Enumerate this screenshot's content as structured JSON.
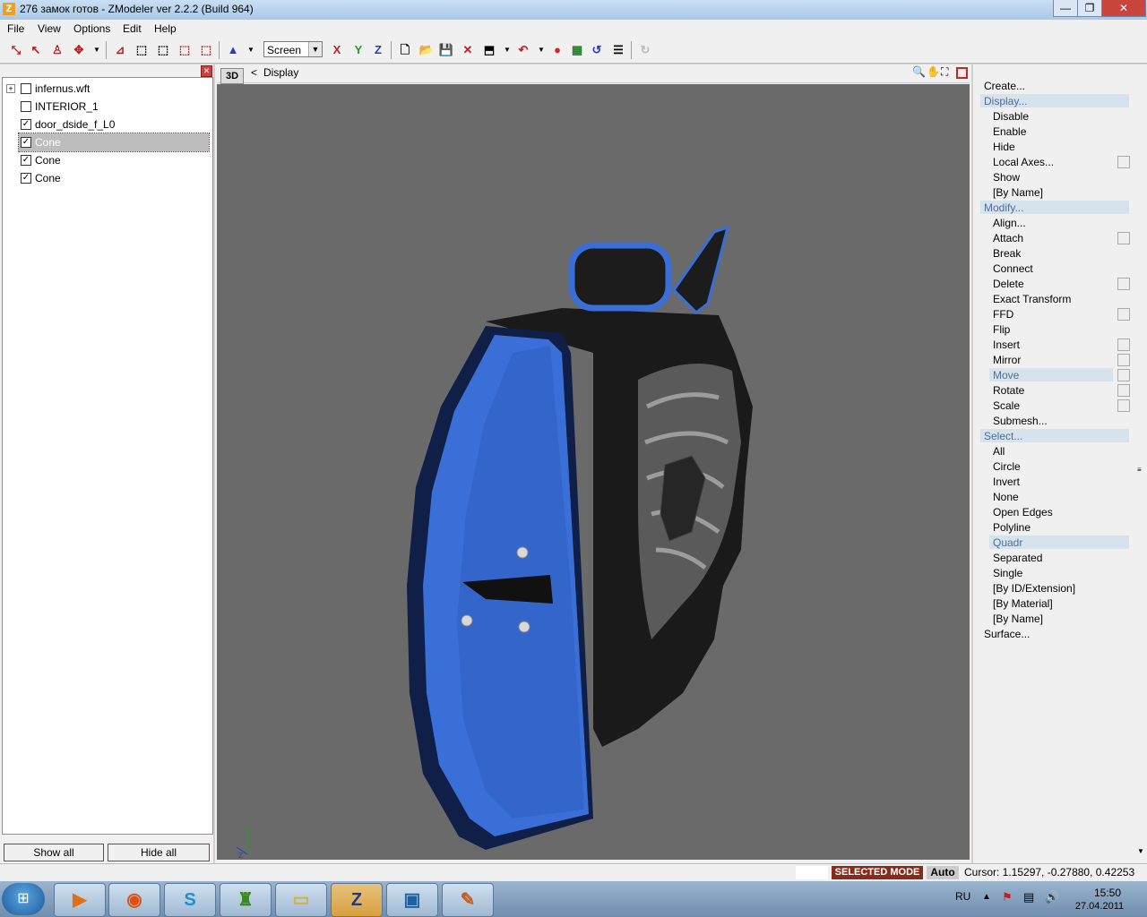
{
  "window": {
    "title": "276 замок готов - ZModeler ver 2.2.2 (Build 964)",
    "app_icon": "Z",
    "controls": {
      "minimize": "—",
      "maximize": "❐",
      "close": "✕"
    }
  },
  "menu": [
    "File",
    "View",
    "Options",
    "Edit",
    "Help"
  ],
  "toolbar": {
    "coord_mode": "Screen",
    "axis_x": "X",
    "axis_y": "Y",
    "axis_z": "Z"
  },
  "object_tree": {
    "items": [
      {
        "label": "infernus.wft",
        "expander": "+",
        "checked": ""
      },
      {
        "label": "INTERIOR_1",
        "expander": "",
        "checked": ""
      },
      {
        "label": "door_dside_f_L0",
        "expander": "",
        "checked": "✓"
      },
      {
        "label": "Cone",
        "expander": "",
        "checked": "✓",
        "selected": true
      },
      {
        "label": "Cone",
        "expander": "",
        "checked": "✓"
      },
      {
        "label": "Cone",
        "expander": "",
        "checked": "✓"
      }
    ],
    "show_all": "Show all",
    "hide_all": "Hide all"
  },
  "viewport": {
    "view_button": "3D",
    "nav_arrow": "<",
    "label": "Display",
    "axis_y": "Y",
    "axis_z": "Z",
    "colors": {
      "background": "#6a6a6a",
      "door_blue": "#3b6fd8",
      "door_black": "#1a1a1a"
    }
  },
  "commands": {
    "create": "Create...",
    "display": {
      "header": "Display...",
      "items": [
        "Disable",
        "Enable",
        "Hide",
        "Local Axes...",
        "Show",
        "[By Name]"
      ]
    },
    "modify": {
      "header": "Modify...",
      "items": [
        "Align...",
        "Attach",
        "Break",
        "Connect",
        "Delete",
        "Exact Transform",
        "FFD",
        "Flip",
        "Insert",
        "Mirror",
        "Move",
        "Rotate",
        "Scale",
        "Submesh..."
      ]
    },
    "select": {
      "header": "Select...",
      "items": [
        "All",
        "Circle",
        "Invert",
        "None",
        "Open Edges",
        "Polyline",
        "Quadr",
        "Separated",
        "Single",
        "[By ID/Extension]",
        "[By Material]",
        "[By Name]"
      ]
    },
    "surface": "Surface..."
  },
  "status": {
    "mode": "SELECTED MODE",
    "auto": "Auto",
    "cursor": "Cursor: 1.15297, -0.27880, 0.42253"
  },
  "taskbar": {
    "lang": "RU",
    "time": "15:50",
    "date": "27.04.2011",
    "apps": [
      "media-player-icon",
      "firefox-icon",
      "skype-icon",
      "app-icon",
      "folder-icon",
      "zmodeler-icon",
      "image-viewer-icon",
      "paint-icon"
    ]
  }
}
